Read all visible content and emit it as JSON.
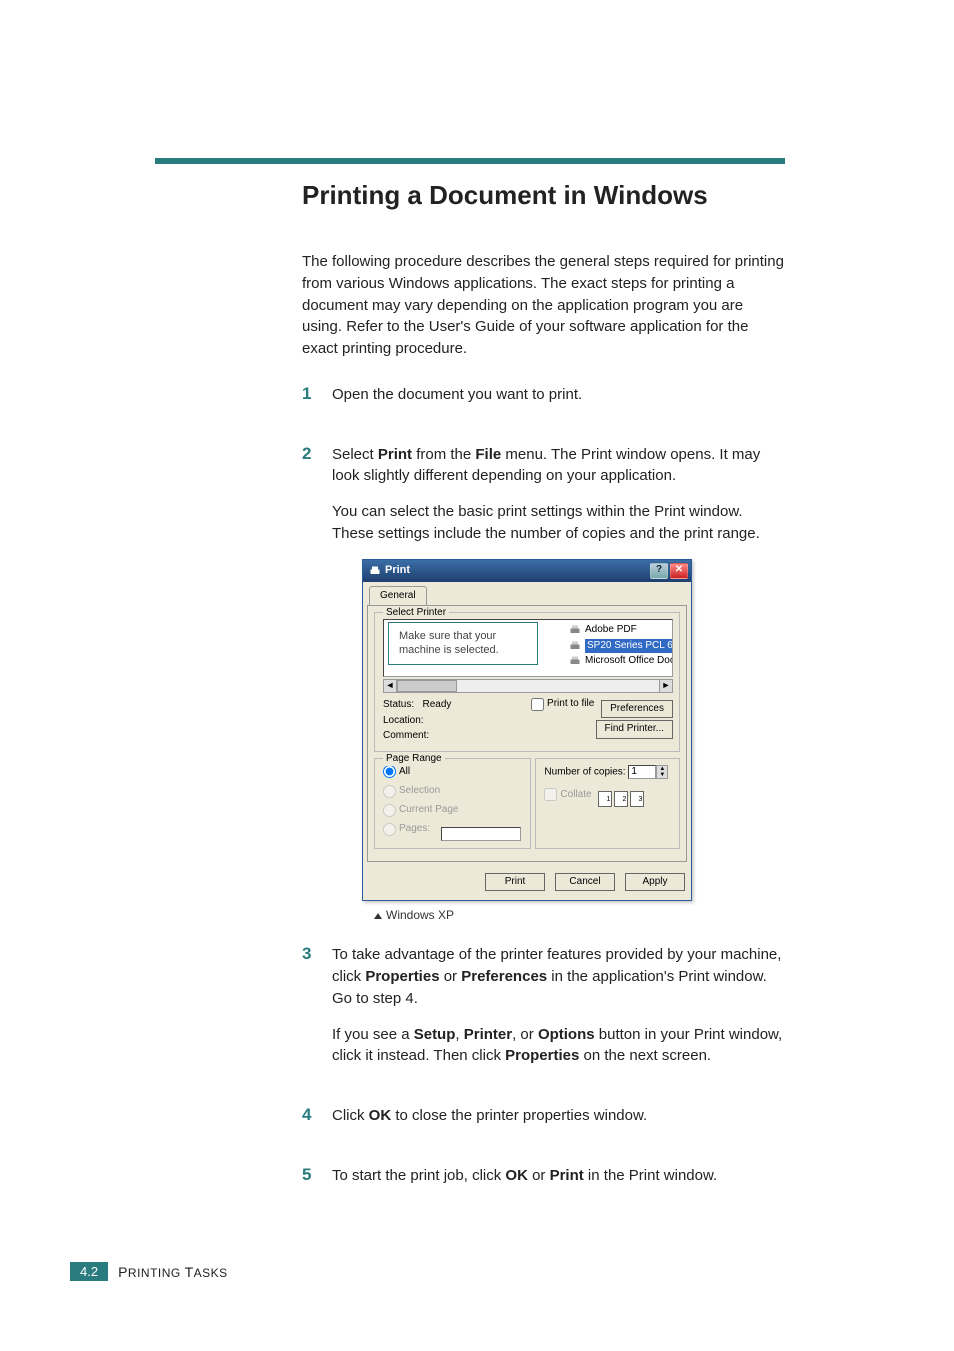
{
  "heading": "Printing a Document in Windows",
  "intro": "The following procedure describes the general steps required for printing from various Windows applications. The exact steps for printing a document may vary depending on the application program you are using. Refer to the User's Guide of your software application for the exact printing procedure.",
  "steps": {
    "s1": {
      "num": "1",
      "text": "Open the document you want to print."
    },
    "s2": {
      "num": "2",
      "p1_a": "Select ",
      "p1_b": "Print",
      "p1_c": " from the ",
      "p1_d": "File",
      "p1_e": " menu. The Print window opens. It may look slightly different depending on your application.",
      "p2": "You can select the basic print settings within the Print window. These settings include the number of copies and the print range."
    },
    "s3": {
      "num": "3",
      "p1_a": "To take advantage of the printer features provided by your machine, click ",
      "p1_b": "Properties",
      "p1_c": " or ",
      "p1_d": "Preferences",
      "p1_e": " in the application's Print window. Go to step 4.",
      "p2_a": "If you see a ",
      "p2_b": "Setup",
      "p2_c": ", ",
      "p2_d": "Printer",
      "p2_e": ", or ",
      "p2_f": "Options",
      "p2_g": " button in your Print window, click it instead. Then click ",
      "p2_h": "Properties",
      "p2_i": " on the next screen."
    },
    "s4": {
      "num": "4",
      "a": "Click ",
      "b": "OK",
      "c": " to close the printer properties window."
    },
    "s5": {
      "num": "5",
      "a": "To start the print job, click ",
      "b": "OK",
      "c": " or ",
      "d": "Print",
      "e": " in the Print window."
    }
  },
  "dialog": {
    "title": "Print",
    "tab": "General",
    "group_select_printer": "Select Printer",
    "callout": "Make sure that your machine is selected.",
    "printers": {
      "p1": "Adobe PDF",
      "p2": "SP20 Series PCL 6",
      "p3": "Microsoft Office Document Imag"
    },
    "status_label": "Status:",
    "status_value": "Ready",
    "location_label": "Location:",
    "comment_label": "Comment:",
    "print_to_file": "Print to file",
    "preferences_btn": "Preferences",
    "find_printer_btn": "Find Printer...",
    "group_page_range": "Page Range",
    "all": "All",
    "selection": "Selection",
    "current_page": "Current Page",
    "pages": "Pages:",
    "num_copies_label": "Number of copies:",
    "num_copies_value": "1",
    "collate": "Collate",
    "print_btn": "Print",
    "cancel_btn": "Cancel",
    "apply_btn": "Apply",
    "caption": "Windows XP"
  },
  "footer": {
    "badge": "4.2",
    "text_caps": "P",
    "text_rest": "RINTING ",
    "text_caps2": "T",
    "text_rest2": "ASKS"
  }
}
